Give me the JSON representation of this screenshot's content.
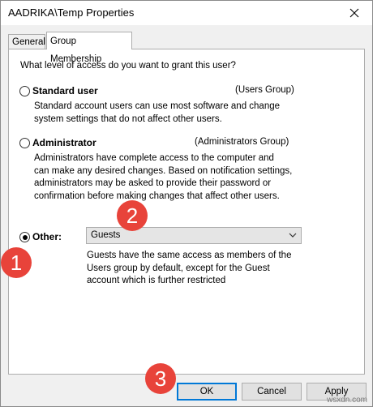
{
  "window": {
    "title": "AADRIKA\\Temp Properties"
  },
  "tabs": [
    {
      "label": "General"
    },
    {
      "label": "Group Membership"
    }
  ],
  "question": "What level of access do you want to grant this user?",
  "options": {
    "standard": {
      "label": "Standard user",
      "group": "(Users Group)",
      "desc1": "Standard account users can use most software and change",
      "desc2": "system settings that do not affect other users."
    },
    "admin": {
      "label": "Administrator",
      "group": "(Administrators Group)",
      "desc1": "Administrators have complete access to the computer and",
      "desc2": "can make any desired changes. Based on notification settings,",
      "desc3": "administrators may be asked to provide their password or",
      "desc4": "confirmation before making changes that affect other users."
    },
    "other": {
      "label": "Other:",
      "selected": "Guests",
      "desc1": "Guests have the same access as members of the",
      "desc2": "Users group by default, except for the Guest",
      "desc3": "account which is further restricted"
    }
  },
  "buttons": {
    "ok": "OK",
    "cancel": "Cancel",
    "apply": "Apply"
  },
  "badges": {
    "one": "1",
    "two": "2",
    "three": "3"
  },
  "watermark": "wsxdn.com",
  "colors": {
    "badge": "#e8433a",
    "focus": "#0078d7"
  }
}
